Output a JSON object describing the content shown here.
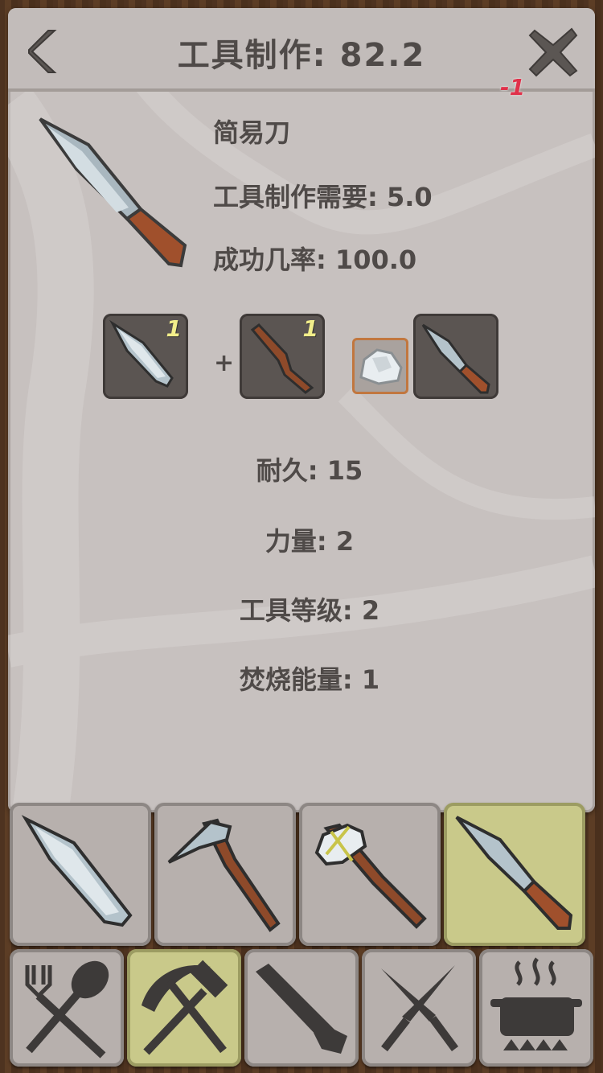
{
  "header": {
    "title": "工具制作: 82.2",
    "floating_change": "-1"
  },
  "item": {
    "name": "简易刀",
    "requirement": "工具制作需要: 5.0",
    "success_rate": "成功几率: 100.0"
  },
  "recipe": {
    "ingredients": [
      {
        "icon": "stone-blade-icon",
        "count": "1"
      },
      {
        "icon": "stick-icon",
        "count": "1"
      }
    ],
    "plus": "+",
    "tool_icon": "rock-icon",
    "result_icon": "simple-knife-icon"
  },
  "stats": {
    "durability": "耐久: 15",
    "strength": "力量: 2",
    "tool_level": "工具等级: 2",
    "burn_energy": "焚烧能量: 1"
  },
  "recipes_bar": [
    {
      "icon": "stone-blade-icon",
      "active": false
    },
    {
      "icon": "stone-pick-icon",
      "active": false
    },
    {
      "icon": "stone-hammer-icon",
      "active": false
    },
    {
      "icon": "simple-knife-icon",
      "active": true
    }
  ],
  "category_tabs": [
    {
      "icon": "fork-spoon-icon",
      "active": false
    },
    {
      "icon": "pick-hammer-icon",
      "active": true
    },
    {
      "icon": "saw-icon",
      "active": false
    },
    {
      "icon": "crossed-knives-icon",
      "active": false
    },
    {
      "icon": "cooking-pot-icon",
      "active": false
    }
  ],
  "colors": {
    "panel": "#c7c1bf",
    "text": "#4f4a48",
    "active_tab": "#c9c98a",
    "count": "#f2ee8a",
    "minus": "#e0314a"
  }
}
